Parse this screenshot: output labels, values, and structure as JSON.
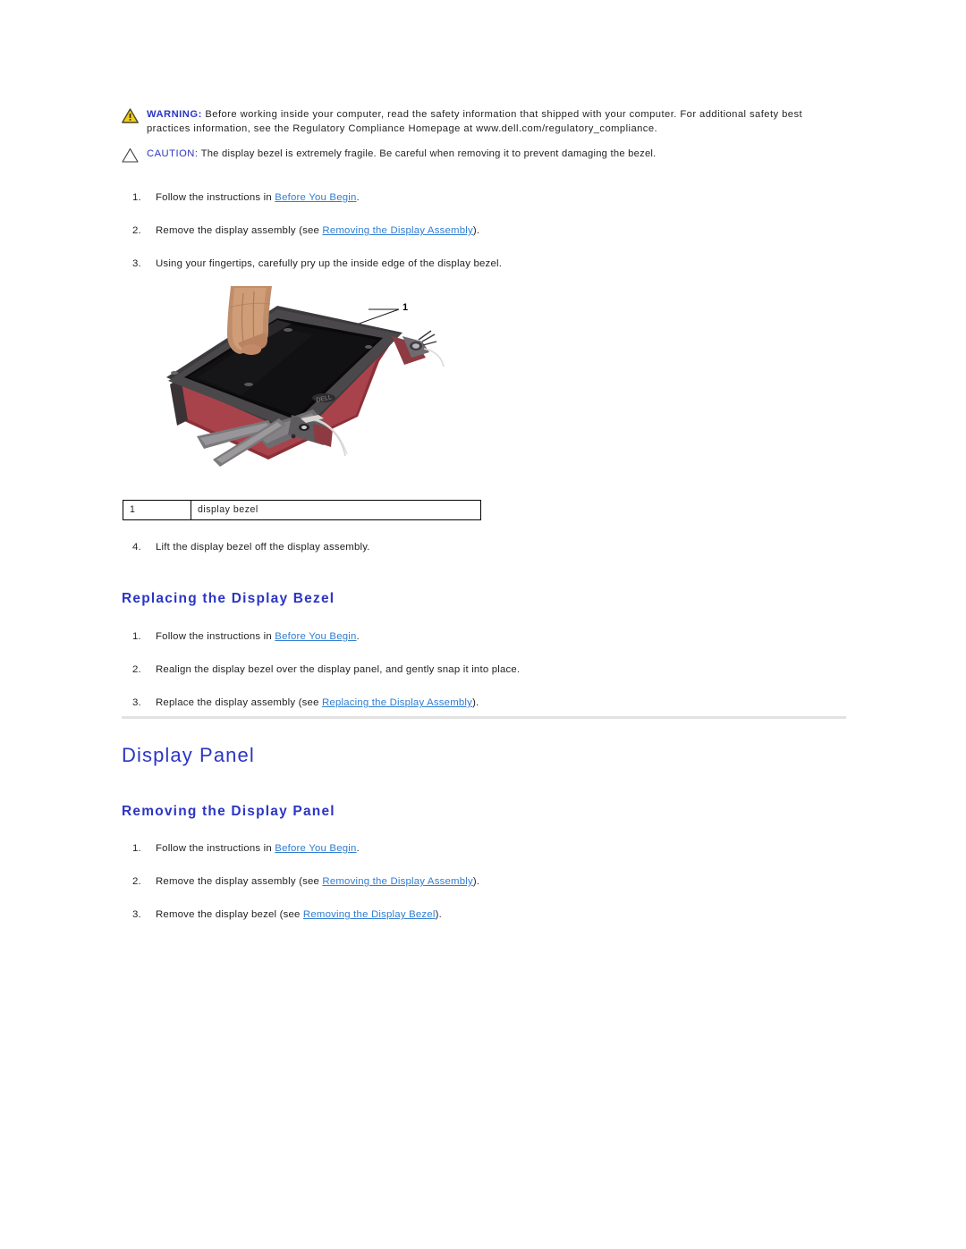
{
  "admonitions": [
    {
      "icon": "warning-triangle-icon",
      "label": "WARNING:",
      "text": " Before working inside your computer, read the safety information that shipped with your computer. For additional safety best practices information, see the Regulatory Compliance Homepage at www.dell.com/regulatory_compliance."
    },
    {
      "icon": "caution-triangle-icon",
      "label": "CAUTION:",
      "text": " The display bezel is extremely fragile. Be careful when removing it to prevent damaging the bezel."
    }
  ],
  "removing_bezel_steps": [
    {
      "num": "1.",
      "pre": "Follow the instructions in ",
      "link": "Before You Begin",
      "post": "."
    },
    {
      "num": "2.",
      "pre": "Remove the display assembly (see ",
      "link": "Removing the Display Assembly",
      "post": ")."
    },
    {
      "num": "3.",
      "pre": "Using your fingertips, carefully pry up the inside edge of the display bezel.",
      "link": "",
      "post": ""
    }
  ],
  "figure": {
    "callout_number": "1",
    "alt": "Laptop display assembly with a hand prying up the display bezel"
  },
  "legend_table": {
    "rows": [
      {
        "key": "1",
        "value": "display bezel"
      }
    ]
  },
  "step_lift": {
    "num": "4.",
    "text": "Lift the display bezel off the display assembly."
  },
  "headings": {
    "replacing_display_bezel": "Replacing the Display Bezel",
    "display_panel": "Display Panel",
    "removing_display_panel": "Removing the Display Panel"
  },
  "replacing_bezel_steps": [
    {
      "num": "1.",
      "pre": "Follow the instructions in ",
      "link": "Before You Begin",
      "post": "."
    },
    {
      "num": "2.",
      "pre": "Realign the display bezel over the display panel, and gently snap it into place.",
      "link": "",
      "post": ""
    },
    {
      "num": "3.",
      "pre": "Replace the display assembly (see ",
      "link": "Replacing the Display Assembly",
      "post": ")."
    }
  ],
  "removing_panel_steps": [
    {
      "num": "1.",
      "pre": "Follow the instructions in ",
      "link": "Before You Begin",
      "post": "."
    },
    {
      "num": "2.",
      "pre": "Remove the display assembly (see ",
      "link": "Removing the Display Assembly",
      "post": ")."
    },
    {
      "num": "3.",
      "pre": "Remove the display bezel (see ",
      "link": "Removing the Display Bezel",
      "post": ")."
    }
  ],
  "colors": {
    "heading_blue": "#2b35c4",
    "link_blue": "#2f7dd1",
    "body_black": "#231f20",
    "warning_triangle_fill": "#f2cb1d",
    "rule_gray": "#e2e2e2"
  }
}
